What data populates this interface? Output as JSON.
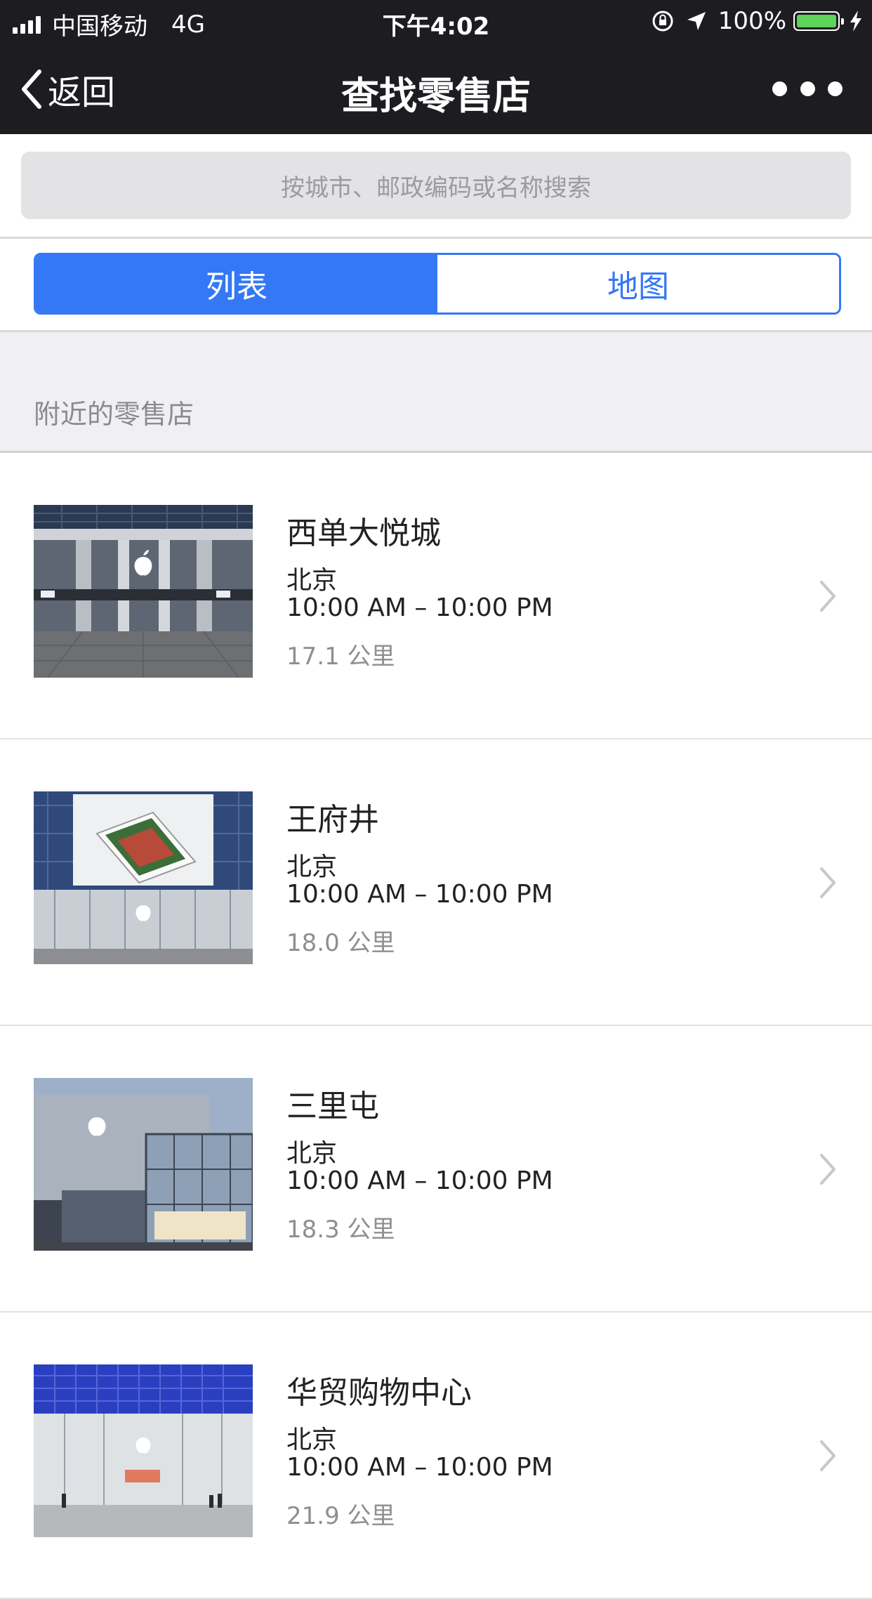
{
  "status_bar": {
    "carrier": "中国移动",
    "network": "4G",
    "time": "下午4:02",
    "battery": "100%"
  },
  "nav": {
    "back_label": "返回",
    "title": "查找零售店"
  },
  "search": {
    "placeholder": "按城市、邮政编码或名称搜索"
  },
  "segment": {
    "list_label": "列表",
    "map_label": "地图",
    "selected": "列表"
  },
  "section": {
    "title": "附近的零售店"
  },
  "stores": [
    {
      "name": "西单大悦城",
      "city": "北京",
      "hours": "10:00 AM – 10:00 PM",
      "distance": "17.1 公里"
    },
    {
      "name": "王府井",
      "city": "北京",
      "hours": "10:00 AM – 10:00 PM",
      "distance": "18.0 公里"
    },
    {
      "name": "三里屯",
      "city": "北京",
      "hours": "10:00 AM – 10:00 PM",
      "distance": "18.3 公里"
    },
    {
      "name": "华贸购物中心",
      "city": "北京",
      "hours": "10:00 AM – 10:00 PM",
      "distance": "21.9 公里"
    }
  ],
  "colors": {
    "accent": "#3478f6",
    "nav_bg": "#1d1d21",
    "battery": "#5ed35a"
  }
}
